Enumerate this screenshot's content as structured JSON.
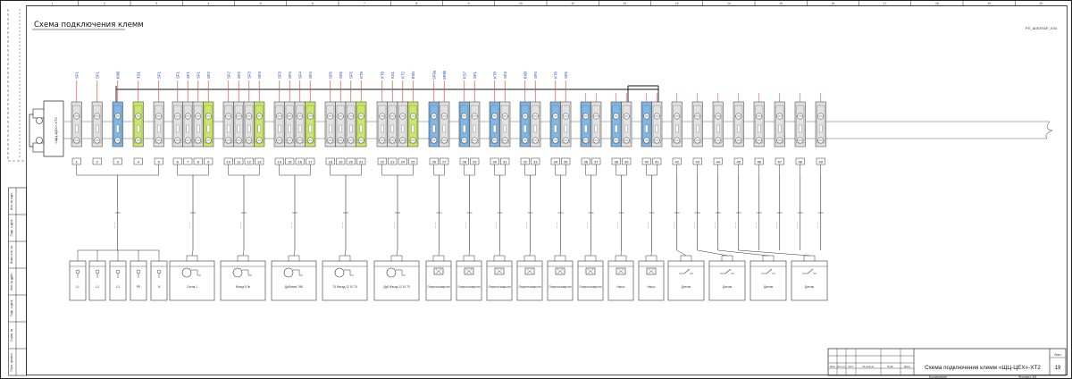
{
  "sheet": {
    "title": "Схема подключения клемм",
    "doc_code": "РП_ШЭОПАР_ХЗ4",
    "connector_label": "«ЩЦ-ЦЕХ»-ХТ2",
    "grid_numbers": [
      "1",
      "2",
      "3",
      "4",
      "5",
      "6",
      "7",
      "8",
      "9",
      "10",
      "11",
      "12",
      "13",
      "14",
      "15",
      "16",
      "17",
      "18",
      "19",
      "20"
    ]
  },
  "terminals": {
    "top_labels": [
      "SF1",
      "SF1",
      "KM5",
      "XS1",
      "SF1",
      "SF1",
      "SF1",
      "SF1",
      "SF2",
      "SF2",
      "SF2",
      "SF3",
      "SF3",
      "SF3",
      "SF4",
      "SF4",
      "SF4",
      "SF5",
      "SF5",
      "SF5",
      "KT9",
      "KT8",
      "KS1",
      "KT2",
      "KM1",
      "SF9a",
      "SF9b",
      "KS7",
      "SF1",
      "KT8",
      "SF3",
      "KM3",
      "SF4",
      "KT8",
      "SF5"
    ],
    "bottom_numbers": [
      "1",
      "2",
      "3",
      "4",
      "5",
      "6",
      "7",
      "8",
      "9",
      "10",
      "11",
      "12",
      "13",
      "14",
      "15",
      "16",
      "17",
      "18",
      "19",
      "20",
      "21",
      "22",
      "23",
      "24",
      "25",
      "26",
      "27",
      "28",
      "29",
      "30",
      "31",
      "32",
      "33",
      "34",
      "35",
      "36",
      "37",
      "38",
      "39",
      "40",
      "41",
      "42",
      "43",
      "44",
      "45",
      "46",
      "47",
      "48",
      "49"
    ]
  },
  "devices": [
    {
      "label": "L1"
    },
    {
      "label": "L2"
    },
    {
      "label": "L3"
    },
    {
      "label": "PE"
    },
    {
      "label": "N"
    },
    {
      "label": "Сосна 1"
    },
    {
      "label": "Фасад 5 3п"
    },
    {
      "label": "Дуб/хвоя 7/60"
    },
    {
      "label": "Т4 Фасад 12 10 75"
    },
    {
      "label": "Дуб Фасад 12 10 75"
    },
    {
      "label": "Открыто/закрыто"
    },
    {
      "label": "Открыто/закрыто"
    },
    {
      "label": "Открыто/закрыто"
    },
    {
      "label": "Открыто/закрыто"
    },
    {
      "label": "Открыто/закрыто"
    },
    {
      "label": "Открыто/закрыто"
    },
    {
      "label": "Насос"
    },
    {
      "label": "Насос"
    },
    {
      "label": "Датчик"
    },
    {
      "label": "Датчик"
    },
    {
      "label": "Датчик"
    },
    {
      "label": "Датчик"
    }
  ],
  "title_block": {
    "name": "Схема подключения клемм «ЩЦ-ЦЕХ»-ХТ2",
    "sheet_label": "Лист",
    "sheet_number": "19",
    "format": "Формат А3",
    "copied": "Копировал",
    "cols": [
      "Изм.",
      "Кол.уч",
      "Лист",
      "№ докум.",
      "Подп.",
      "Дата"
    ]
  },
  "side_stamp": [
    "Инв. № подл.",
    "Подп. и дата",
    "Взам. инв. №",
    "Инв. № дубл.",
    "Подп. и дата",
    "Справ. №",
    "Перв. примен."
  ],
  "colors": {
    "blue_terminal": "#7fb8e6",
    "green_yellow_pe": "#c9e86a",
    "gray_terminal": "#e2e2e2",
    "red_wire": "#e05050",
    "blue_text": "#2030c0"
  }
}
